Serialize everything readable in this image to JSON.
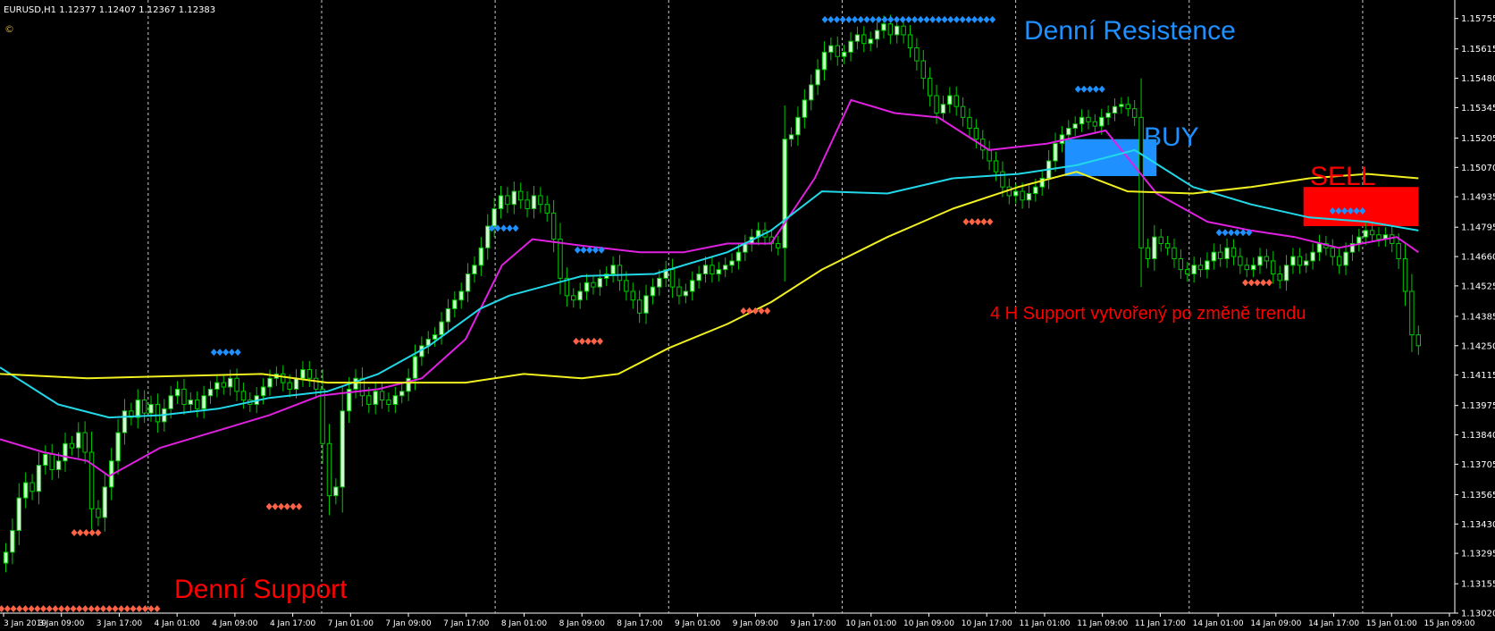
{
  "header": {
    "symbol": "EURUSD,H1",
    "ohlc": "1.12377 1.12407 1.12367 1.12383",
    "logo_icon": "copyright-icon"
  },
  "colors": {
    "background": "#000000",
    "grid": "#c8c8c8",
    "axis_text": "#ffffff",
    "candle_bull_body": "#ccffcc",
    "candle_bear_body": "#000000",
    "candle_outline": "#00c800",
    "ma_fast": "#e020e0",
    "ma_mid": "#22d8e8",
    "ma_slow": "#f0f020",
    "resistance_marker": "#1e90ff",
    "support_marker": "#ff6347",
    "buy_zone": "#1e90ff",
    "sell_zone": "#ff0000"
  },
  "annotations": {
    "daily_resistance": "Denní Resistence",
    "daily_support": "Denní Support",
    "buy": "BUY",
    "sell": "SELL",
    "h4_support": "4 H Support vytvořený po změně trendu"
  },
  "chart_data": {
    "type": "candlestick",
    "symbol": "EURUSD",
    "timeframe": "H1",
    "ylim": [
      1.1302,
      1.1584
    ],
    "y_ticks": [
      "1.15755",
      "1.15615",
      "1.15480",
      "1.15345",
      "1.15205",
      "1.15070",
      "1.14935",
      "1.14795",
      "1.14660",
      "1.14525",
      "1.14385",
      "1.14250",
      "1.14115",
      "1.13975",
      "1.13840",
      "1.13705",
      "1.13565",
      "1.13430",
      "1.13295",
      "1.13155",
      "1.13020"
    ],
    "x_ticks": [
      "3 Jan 2019",
      "3 Jan 09:00",
      "3 Jan 17:00",
      "4 Jan 01:00",
      "4 Jan 09:00",
      "4 Jan 17:00",
      "7 Jan 01:00",
      "7 Jan 09:00",
      "7 Jan 17:00",
      "8 Jan 01:00",
      "8 Jan 09:00",
      "8 Jan 17:00",
      "9 Jan 01:00",
      "9 Jan 09:00",
      "9 Jan 17:00",
      "10 Jan 01:00",
      "10 Jan 09:00",
      "10 Jan 17:00",
      "11 Jan 01:00",
      "11 Jan 09:00",
      "11 Jan 17:00",
      "14 Jan 01:00",
      "14 Jan 09:00",
      "14 Jan 17:00",
      "15 Jan 01:00",
      "15 Jan 09:00"
    ],
    "separator_after_tick": [
      2,
      5,
      8,
      11,
      14,
      17,
      20,
      23
    ],
    "close": [
      1.133,
      1.134,
      1.1355,
      1.1362,
      1.1358,
      1.137,
      1.1375,
      1.1368,
      1.1372,
      1.138,
      1.1378,
      1.1385,
      1.1376,
      1.135,
      1.1346,
      1.136,
      1.1372,
      1.1385,
      1.1395,
      1.1392,
      1.14,
      1.1394,
      1.1398,
      1.139,
      1.1396,
      1.1402,
      1.1405,
      1.1398,
      1.14,
      1.1396,
      1.1402,
      1.1405,
      1.1408,
      1.1406,
      1.141,
      1.1404,
      1.14,
      1.1398,
      1.1402,
      1.1406,
      1.141,
      1.1412,
      1.1408,
      1.1405,
      1.141,
      1.1414,
      1.141,
      1.1405,
      1.138,
      1.1356,
      1.136,
      1.1395,
      1.1405,
      1.141,
      1.1402,
      1.1398,
      1.1404,
      1.14,
      1.1398,
      1.1402,
      1.1404,
      1.141,
      1.142,
      1.1425,
      1.1428,
      1.143,
      1.1436,
      1.1442,
      1.1446,
      1.145,
      1.1458,
      1.1462,
      1.147,
      1.148,
      1.1488,
      1.1494,
      1.149,
      1.1496,
      1.1492,
      1.1488,
      1.1494,
      1.149,
      1.1486,
      1.1474,
      1.1456,
      1.1448,
      1.1446,
      1.145,
      1.1454,
      1.1452,
      1.1456,
      1.1458,
      1.1462,
      1.1455,
      1.145,
      1.1446,
      1.144,
      1.1448,
      1.1452,
      1.1456,
      1.146,
      1.1452,
      1.1448,
      1.145,
      1.1455,
      1.1458,
      1.1462,
      1.1458,
      1.146,
      1.1462,
      1.1464,
      1.1468,
      1.1472,
      1.1475,
      1.1478,
      1.1475,
      1.1472,
      1.147,
      1.152,
      1.1522,
      1.153,
      1.1538,
      1.1545,
      1.1552,
      1.156,
      1.1563,
      1.1558,
      1.156,
      1.1565,
      1.1568,
      1.1564,
      1.1566,
      1.157,
      1.1573,
      1.1568,
      1.1572,
      1.1568,
      1.1562,
      1.1556,
      1.1548,
      1.154,
      1.1532,
      1.1536,
      1.154,
      1.1535,
      1.153,
      1.1525,
      1.152,
      1.1515,
      1.151,
      1.1505,
      1.1498,
      1.1494,
      1.1496,
      1.1492,
      1.1495,
      1.1498,
      1.1502,
      1.151,
      1.1518,
      1.1522,
      1.1525,
      1.1527,
      1.153,
      1.1528,
      1.1526,
      1.153,
      1.1532,
      1.1535,
      1.1536,
      1.1534,
      1.153,
      1.147,
      1.1465,
      1.1475,
      1.1472,
      1.147,
      1.1465,
      1.146,
      1.1458,
      1.1462,
      1.146,
      1.1464,
      1.1468,
      1.1465,
      1.147,
      1.1466,
      1.1462,
      1.146,
      1.1462,
      1.1466,
      1.1464,
      1.1458,
      1.1455,
      1.1462,
      1.1466,
      1.1462,
      1.1464,
      1.1468,
      1.1472,
      1.147,
      1.1466,
      1.1462,
      1.1468,
      1.1472,
      1.1475,
      1.1478,
      1.1476,
      1.1474,
      1.1476,
      1.1472,
      1.1465,
      1.145,
      1.143,
      1.1425
    ],
    "series": [
      {
        "name": "",
        "role": "ma_fast",
        "y": [
          [
            0,
            1.1382
          ],
          [
            0.03,
            1.1376
          ],
          [
            0.06,
            1.1372
          ],
          [
            0.075,
            1.1365
          ],
          [
            0.11,
            1.1378
          ],
          [
            0.15,
            1.1386
          ],
          [
            0.185,
            1.1393
          ],
          [
            0.22,
            1.1402
          ],
          [
            0.26,
            1.1405
          ],
          [
            0.29,
            1.141
          ],
          [
            0.32,
            1.1428
          ],
          [
            0.345,
            1.1462
          ],
          [
            0.366,
            1.1474
          ],
          [
            0.4,
            1.1471
          ],
          [
            0.44,
            1.1468
          ],
          [
            0.47,
            1.1468
          ],
          [
            0.5,
            1.1472
          ],
          [
            0.53,
            1.1472
          ],
          [
            0.56,
            1.1502
          ],
          [
            0.585,
            1.1538
          ],
          [
            0.615,
            1.1532
          ],
          [
            0.645,
            1.153
          ],
          [
            0.68,
            1.1515
          ],
          [
            0.72,
            1.1518
          ],
          [
            0.76,
            1.1524
          ],
          [
            0.795,
            1.1495
          ],
          [
            0.83,
            1.1482
          ],
          [
            0.86,
            1.1478
          ],
          [
            0.89,
            1.1475
          ],
          [
            0.92,
            1.147
          ],
          [
            0.96,
            1.1475
          ],
          [
            0.975,
            1.1468
          ]
        ]
      },
      {
        "name": "",
        "role": "ma_mid",
        "y": [
          [
            0,
            1.1415
          ],
          [
            0.04,
            1.1398
          ],
          [
            0.075,
            1.1392
          ],
          [
            0.11,
            1.1393
          ],
          [
            0.15,
            1.1396
          ],
          [
            0.185,
            1.1401
          ],
          [
            0.225,
            1.1404
          ],
          [
            0.26,
            1.1412
          ],
          [
            0.295,
            1.1425
          ],
          [
            0.33,
            1.1442
          ],
          [
            0.35,
            1.1448
          ],
          [
            0.4,
            1.1457
          ],
          [
            0.45,
            1.1458
          ],
          [
            0.5,
            1.1468
          ],
          [
            0.53,
            1.1478
          ],
          [
            0.565,
            1.1496
          ],
          [
            0.61,
            1.1495
          ],
          [
            0.655,
            1.1502
          ],
          [
            0.7,
            1.1504
          ],
          [
            0.74,
            1.1508
          ],
          [
            0.78,
            1.1515
          ],
          [
            0.82,
            1.1498
          ],
          [
            0.86,
            1.149
          ],
          [
            0.9,
            1.1484
          ],
          [
            0.94,
            1.1482
          ],
          [
            0.975,
            1.1478
          ]
        ]
      },
      {
        "name": "",
        "role": "ma_slow",
        "y": [
          [
            0,
            1.1412
          ],
          [
            0.06,
            1.141
          ],
          [
            0.12,
            1.1411
          ],
          [
            0.18,
            1.1412
          ],
          [
            0.225,
            1.1408
          ],
          [
            0.27,
            1.1408
          ],
          [
            0.32,
            1.1408
          ],
          [
            0.36,
            1.1412
          ],
          [
            0.4,
            1.141
          ],
          [
            0.425,
            1.1412
          ],
          [
            0.46,
            1.1424
          ],
          [
            0.5,
            1.1435
          ],
          [
            0.53,
            1.1445
          ],
          [
            0.565,
            1.146
          ],
          [
            0.61,
            1.1475
          ],
          [
            0.655,
            1.1488
          ],
          [
            0.7,
            1.1498
          ],
          [
            0.74,
            1.1505
          ],
          [
            0.775,
            1.1496
          ],
          [
            0.82,
            1.1495
          ],
          [
            0.86,
            1.1498
          ],
          [
            0.9,
            1.1502
          ],
          [
            0.94,
            1.1504
          ],
          [
            0.975,
            1.1502
          ]
        ]
      }
    ],
    "resistance_markers": [
      [
        0.567,
        0.682,
        1.1575
      ],
      [
        0.741,
        0.758,
        1.1543
      ],
      [
        0.338,
        0.356,
        1.1479
      ],
      [
        0.397,
        0.414,
        1.1469
      ],
      [
        0.147,
        0.165,
        1.1422
      ],
      [
        0.838,
        0.857,
        1.1477
      ],
      [
        0.916,
        0.935,
        1.1487
      ]
    ],
    "support_markers": [
      [
        0.001,
        0.108,
        1.1304
      ],
      [
        0.051,
        0.069,
        1.1339
      ],
      [
        0.185,
        0.204,
        1.1351
      ],
      [
        0.664,
        0.682,
        1.1482
      ],
      [
        0.511,
        0.529,
        1.1441
      ],
      [
        0.396,
        0.414,
        1.1427
      ],
      [
        0.856,
        0.874,
        1.1454
      ]
    ],
    "zones": [
      {
        "role": "buy",
        "x": [
          0.732,
          0.795
        ],
        "y": [
          1.1503,
          1.152
        ]
      },
      {
        "role": "sell",
        "x": [
          0.896,
          0.975
        ],
        "y": [
          1.148,
          1.1498
        ]
      }
    ]
  }
}
